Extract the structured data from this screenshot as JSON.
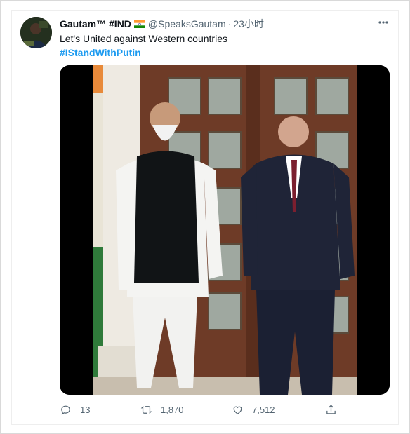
{
  "tweet": {
    "display_name": "Gautam™ #IND",
    "handle": "@SpeaksGautam",
    "separator": "·",
    "time": "23小时",
    "text": "Let's United against Western countries",
    "hashtag": "#IStandWithPutin",
    "more_icon": "more-horizontal-icon"
  },
  "actions": {
    "reply_count": "13",
    "retweet_count": "1,870",
    "like_count": "7,512"
  },
  "colors": {
    "link": "#1d9bf0",
    "secondary_text": "#536471",
    "primary_text": "#0f1419"
  }
}
